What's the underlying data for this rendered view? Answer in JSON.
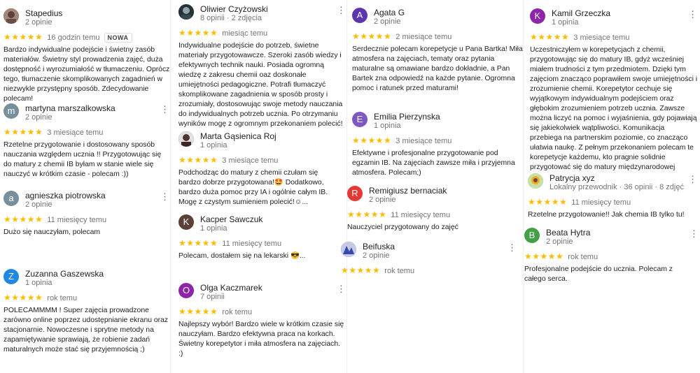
{
  "reviews": {
    "c1": [
      {
        "name": "Stapedius",
        "sub": "2 opinie",
        "stars": "★★★★★",
        "time": "16 godzin temu",
        "badge": "NOWA",
        "text": "Bardzo indywidualne podejście i świetny zasób materiałów. Świetny styl prowadzenia zajęć, duża dostępność i wyrozumiałość w tłumaczeniu. Oprócz tego, tłumaczenie skomplikowanych zagadnień w niezwykle przystępny sposób. Zdecydowanie polecam!",
        "initial": "",
        "color": "#8d6e63"
      },
      {
        "name": "martyna marszalkowska",
        "sub": "2 opinie",
        "stars": "★★★★★",
        "time": "3 miesiące temu",
        "text": "Rzetelne przygotowanie i dostosowany sposób nauczania względem ucznia !! Przygotowując się do matury z chemii IB byłam w stanie wiele się nauczyć w krótkim czasie - polecam :))",
        "initial": "m",
        "color": "#78909c"
      },
      {
        "name": "agnieszka piotrowska",
        "sub": "2 opinie",
        "stars": "★★★★★",
        "time": "11 miesięcy temu",
        "text": "Dużo się nauczyłam, polecam",
        "initial": "a",
        "color": "#78909c"
      },
      {
        "name": "Zuzanna Gaszewska",
        "sub": "1 opinia",
        "stars": "★★★★★",
        "time": "rok temu",
        "text": "POLECAMMMM ! Super zajęcia prowadzone zarówno online poprzez udostępnianie ekranu oraz stacjonarnie. Nowoczesne i sprytne metody na zapamiętywanie sprawiają, że robienie zadań maturalnych może stać się przyjemnością ;)",
        "initial": "Z",
        "color": "#1e88e5"
      }
    ],
    "c2": [
      {
        "name": "Oliwier Czyżowski",
        "sub": "8 opinii · 2 zdjęcia",
        "stars": "★★★★★",
        "time": "miesiąc temu",
        "text": "Indywidualne podejście do potrzeb, świetne materiały przygotowawcze. Szeroki zasób wiedzy i efektywnych technik nauki. Posiada ogromną wiedzę z zakresu chemii oaz doskonałe umiejętności pedagogiczne. Potrafi tłumaczyć skomplikowane zagadnienia w sposób prosty i zrozumiały, dostosowując swoje metody nauczania do indywidualnych potrzeb ucznia. Po otrzymaniu wyników mogę z ogromnym przekonaniem polecić!",
        "initial": "",
        "color": "#455a64"
      },
      {
        "name": "Marta Gąsienica Roj",
        "sub": "1 opinia",
        "stars": "★★★★★",
        "time": "3 miesiące temu",
        "text": "Podchodząc do matury z chemii czułam się bardzo dobrze przygotowana!🤩 Dodatkowo, bardzo duża pomoc przy IA i ogólnie całym IB. Mogę z czystym sumieniem polecić!☺...",
        "initial": "",
        "color": "#5d4037"
      },
      {
        "name": "Kacper Sawczuk",
        "sub": "1 opinia",
        "stars": "★★★★★",
        "time": "11 miesięcy temu",
        "text": "Polecam, dostałem się na lekarski 😎...",
        "initial": "K",
        "color": "#5d4037"
      },
      {
        "name": "Olga Kaczmarek",
        "sub": "7 opinii",
        "stars": "★★★★★",
        "time": "rok temu",
        "text": "Najlepszy wybór! Bardzo wiele w krótkim czasie się nauczyłam. Bardzo efektywna praca na korkach. Świetny korepetytor i miła atmosfera na zajęciach.  :)",
        "initial": "O",
        "color": "#8e24aa"
      }
    ],
    "c3": [
      {
        "name": "Agata G",
        "sub": "2 opinie",
        "stars": "★★★★★",
        "time": "2 miesiące temu",
        "text": "Serdecznie polecam korepetycje u Pana Bartka! Miła atmosfera na zajęciach, tematy oraz pytania maturalne są omawiane bardzo dokładnie, a Pan Bartek zna odpowiedź na każde pytanie. Ogromna pomoc i ratunek przed maturami!",
        "initial": "A",
        "color": "#5e35b1"
      },
      {
        "name": "Emilia Pierzynska",
        "sub": "1 opinia",
        "stars": "★★★★★",
        "time": "3 miesiące temu",
        "text": "Efektywne i profesjonalne przygotowanie pod egzamin IB. Na zajęciach zawsze miła i przyjemna atmosfera. Polecam;)",
        "initial": "E",
        "color": "#7e57c2"
      },
      {
        "name": "Remigiusz bernaciak",
        "sub": "2 opinie",
        "stars": "★★★★★",
        "time": "11 miesięcy temu",
        "text": "Nauczyciel przygotowany do zajęć",
        "initial": "R",
        "color": "#e53935"
      },
      {
        "name": "Beifuska",
        "sub": "2 opinie",
        "stars": "★★★★★",
        "time": "rok temu",
        "text": "",
        "initial": "",
        "color": "#3949ab"
      }
    ],
    "c4": [
      {
        "name": "Kamil Grzeczka",
        "sub": "1 opinia",
        "stars": "★★★★★",
        "time": "3 miesiące temu",
        "text": "Uczestniczyłem w korepetycjach z chemii, przygotowując się do matury IB, gdyż wcześniej miałem trudności z tym przedmiotem. Dzięki tym zajęciom znacząco poprawiłem swoje umiejętności i zrozumienie chemii. Korepetytor cechuje się wyjątkowym indywidualnym podejściem oraz głębokim zrozumieniem potrzeb ucznia. Zawsze można liczyć na pomoc i wyjaśnienia, gdy pojawiają się jakiekolwiek wątpliwości. Komunikacja przebiega na partnerskim poziomie, co znacząco ułatwia naukę. Z pełnym przekonaniem polecam te korepetycje każdemu, kto pragnie solidnie przygotować się do matury międzynarodowej",
        "initial": "K",
        "color": "#8e24aa"
      },
      {
        "name": "Patrycja xyz",
        "sub": "Lokalny przewodnik · 36 opinii · 8 zdjęć",
        "stars": "★★★★★",
        "time": "11 miesięcy temu",
        "text": "Rzetelne przygotowanie!! Jak chemia IB tylko tu!",
        "initial": "",
        "color": "#7cb342"
      },
      {
        "name": "Beata Hytra",
        "sub": "2 opinie",
        "stars": "★★★★★",
        "time": "rok temu",
        "text": "Profesjonalne podejście do ucznia. Polecam z całego serca.",
        "initial": "B",
        "color": "#43a047"
      }
    ]
  }
}
